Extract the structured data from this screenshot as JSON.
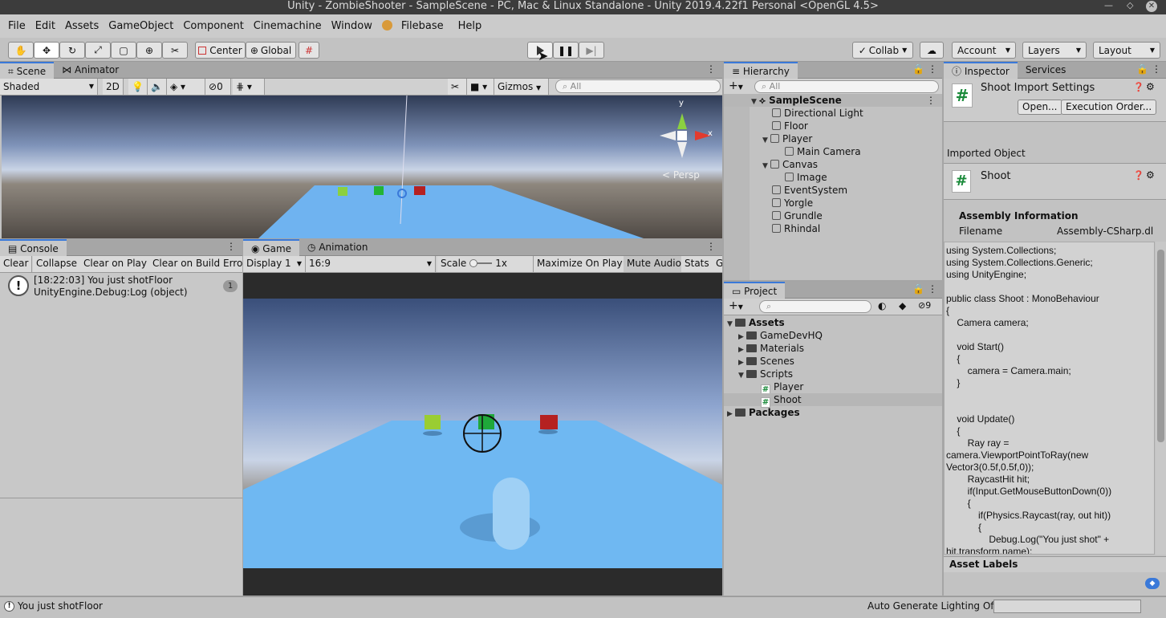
{
  "window": {
    "title": "Unity - ZombieShooter - SampleScene - PC, Mac & Linux Standalone - Unity 2019.4.22f1 Personal <OpenGL 4.5>"
  },
  "menu": [
    "File",
    "Edit",
    "Assets",
    "GameObject",
    "Component",
    "Cinemachine",
    "Window",
    "Filebase",
    "Help"
  ],
  "toolbar": {
    "center": "Center",
    "global": "Global",
    "collab": "Collab",
    "account": "Account",
    "layers": "Layers",
    "layout": "Layout"
  },
  "scene": {
    "tab_scene": "Scene",
    "tab_animator": "Animator",
    "shading": "Shaded",
    "mode_2d": "2D",
    "hidden_count": "0",
    "gizmos": "Gizmos",
    "search_placeholder": "All",
    "persp": "Persp",
    "axis_x": "x",
    "axis_y": "y"
  },
  "console": {
    "tab": "Console",
    "buttons": [
      "Clear",
      "Collapse",
      "Clear on Play",
      "Clear on Build",
      "Erro"
    ],
    "entry_line1": "[18:22:03] You just shotFloor",
    "entry_line2": "UnityEngine.Debug:Log (object)",
    "entry_count": "1"
  },
  "game": {
    "tab_game": "Game",
    "tab_animation": "Animation",
    "display": "Display 1",
    "aspect": "16:9",
    "scale_label": "Scale",
    "scale_value": "1x",
    "maximize": "Maximize On Play",
    "mute": "Mute Audio",
    "stats": "Stats",
    "gizmos_cut": "G"
  },
  "hierarchy": {
    "tab": "Hierarchy",
    "search_placeholder": "All",
    "scene": "SampleScene",
    "items": [
      "Directional Light",
      "Floor",
      "Player",
      "Main Camera",
      "Canvas",
      "Image",
      "EventSystem",
      "Yorgle",
      "Grundle",
      "Rhindal"
    ]
  },
  "project": {
    "tab": "Project",
    "hidden_count": "9",
    "items": [
      "Assets",
      "GameDevHQ",
      "Materials",
      "Scenes",
      "Scripts",
      "Player",
      "Shoot",
      "Packages"
    ]
  },
  "inspector": {
    "tab_inspector": "Inspector",
    "tab_services": "Services",
    "header": "Shoot Import Settings",
    "open": "Open...",
    "exec_order": "Execution Order...",
    "imported_object": "Imported Object",
    "object_name": "Shoot",
    "assembly_info": "Assembly Information",
    "filename_label": "Filename",
    "filename_value": "Assembly-CSharp.dl",
    "asset_labels": "Asset Labels",
    "code": "using System.Collections;\nusing System.Collections.Generic;\nusing UnityEngine;\n\npublic class Shoot : MonoBehaviour\n{\n    Camera camera;\n\n    void Start()\n    {\n        camera = Camera.main;\n    }\n\n\n    void Update()\n    {\n        Ray ray =\ncamera.ViewportPointToRay(new\nVector3(0.5f,0.5f,0));\n        RaycastHit hit;\n        if(Input.GetMouseButtonDown(0))\n        {\n            if(Physics.Raycast(ray, out hit))\n            {\n                Debug.Log(\"You just shot\" +\nhit.transform.name);"
  },
  "status": {
    "message": "You just shotFloor",
    "lighting": "Auto Generate Lighting Off"
  }
}
